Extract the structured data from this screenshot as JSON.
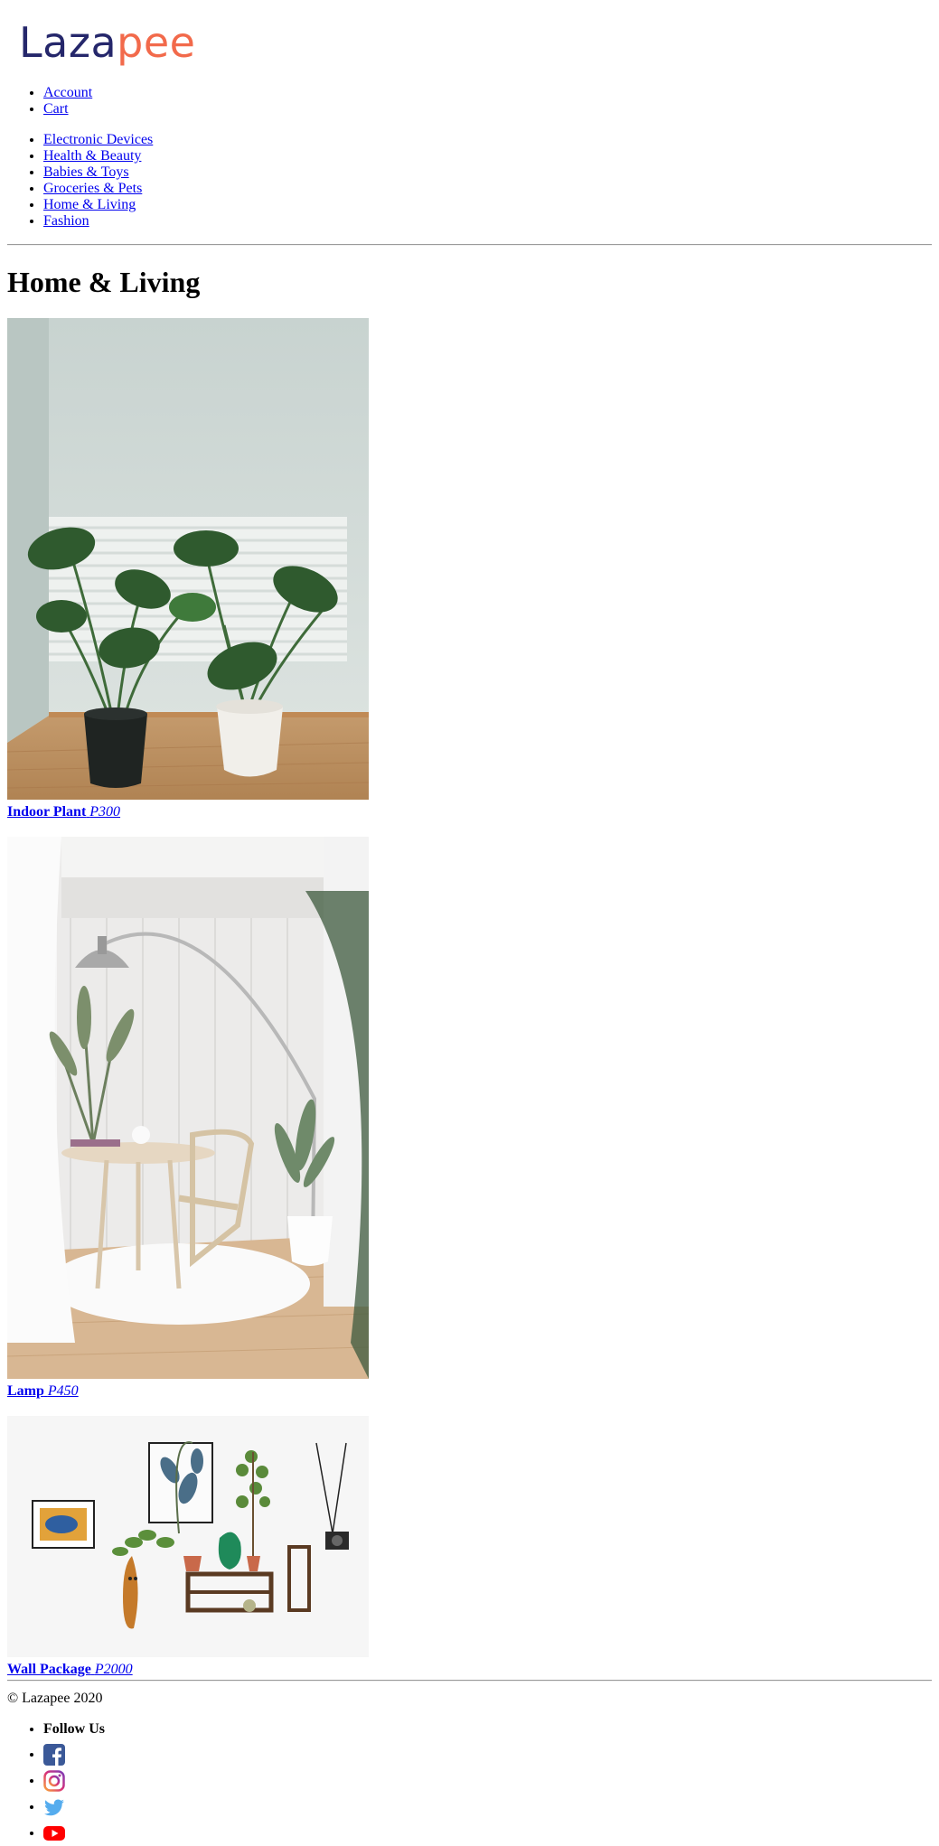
{
  "header": {
    "logo_part1": "Laza",
    "logo_part2": "pee"
  },
  "nav_user": [
    {
      "label": "Account"
    },
    {
      "label": "Cart"
    }
  ],
  "categories": [
    {
      "label": "Electronic Devices"
    },
    {
      "label": "Health & Beauty"
    },
    {
      "label": "Babies & Toys"
    },
    {
      "label": "Groceries & Pets"
    },
    {
      "label": "Home & Living"
    },
    {
      "label": "Fashion"
    }
  ],
  "page": {
    "title": "Home & Living"
  },
  "products": [
    {
      "name": "Indoor Plant",
      "price": "P300"
    },
    {
      "name": "Lamp",
      "price": "P450"
    },
    {
      "name": "Wall Package",
      "price": "P2000"
    }
  ],
  "footer": {
    "copyright": "© Lazapee 2020",
    "follow_heading": "Follow Us",
    "social": [
      {
        "icon": "facebook-icon",
        "color": "#3b5998"
      },
      {
        "icon": "instagram-icon",
        "color": "#c13584"
      },
      {
        "icon": "twitter-icon",
        "color": "#55acee"
      },
      {
        "icon": "youtube-icon",
        "color": "#ff0000"
      }
    ]
  }
}
